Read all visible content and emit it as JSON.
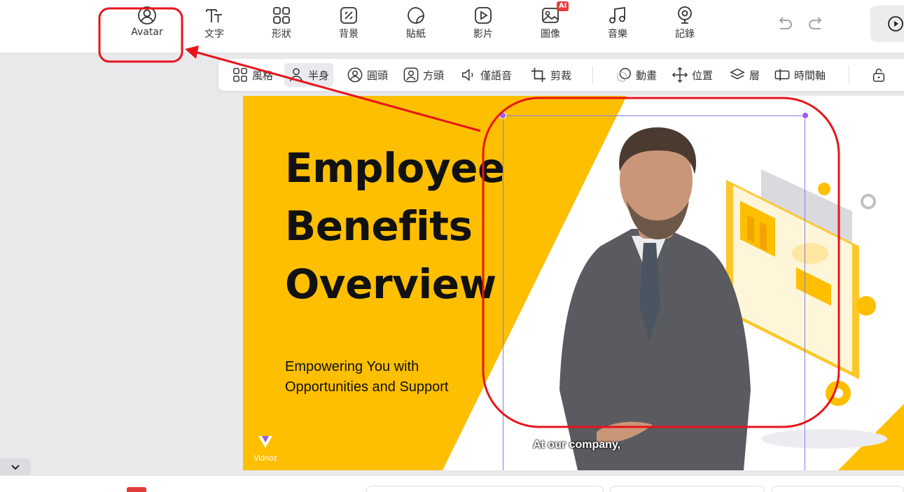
{
  "toolbar": {
    "tools": [
      {
        "label": "Avatar",
        "icon": "avatar-icon"
      },
      {
        "label": "文字",
        "icon": "text-icon"
      },
      {
        "label": "形狀",
        "icon": "shapes-icon"
      },
      {
        "label": "背景",
        "icon": "background-icon"
      },
      {
        "label": "貼紙",
        "icon": "sticker-icon"
      },
      {
        "label": "影片",
        "icon": "video-icon"
      },
      {
        "label": "圖像",
        "icon": "image-icon",
        "badge": "AI"
      },
      {
        "label": "音樂",
        "icon": "music-icon"
      },
      {
        "label": "記錄",
        "icon": "record-icon"
      }
    ]
  },
  "subbar": {
    "items": [
      {
        "label": "風格",
        "icon": "style-grid-icon"
      },
      {
        "label": "半身",
        "icon": "half-body-icon",
        "active": true
      },
      {
        "label": "圓頭",
        "icon": "circle-head-icon"
      },
      {
        "label": "方頭",
        "icon": "square-head-icon"
      },
      {
        "label": "僅語音",
        "icon": "voice-only-icon"
      },
      {
        "label": "剪裁",
        "icon": "crop-icon"
      },
      {
        "label": "動畫",
        "icon": "animation-icon"
      },
      {
        "label": "位置",
        "icon": "position-icon"
      },
      {
        "label": "層",
        "icon": "layers-icon"
      },
      {
        "label": "時間軸",
        "icon": "timeline-icon"
      }
    ]
  },
  "slide": {
    "title_lines": [
      "Employee",
      "Benefits",
      "Overview"
    ],
    "subtitle": "Empowering You with Opportunities and Support",
    "logo_name": "Vidnoz",
    "caption": "At our company,"
  },
  "colors": {
    "accent_yellow": "#fdbf00",
    "annotation_red": "#e8141b",
    "selection_purple": "#9b5cf6"
  }
}
